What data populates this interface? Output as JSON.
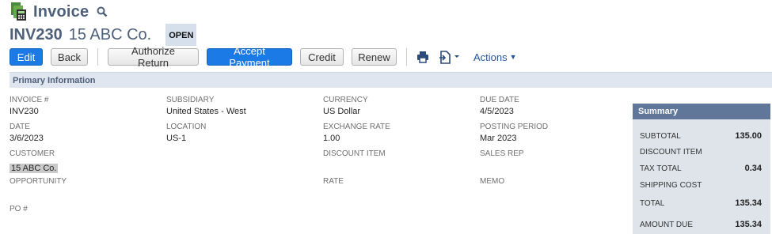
{
  "header": {
    "title": "Invoice",
    "record_id": "INV230",
    "record_name": "15 ABC Co.",
    "status": "OPEN"
  },
  "toolbar": {
    "edit": "Edit",
    "back": "Back",
    "authorize_return": "Authorize Return",
    "accept_payment": "Accept Payment",
    "credit": "Credit",
    "renew": "Renew",
    "actions": "Actions"
  },
  "section": {
    "title": "Primary Information"
  },
  "fields": {
    "invoice_no": {
      "label": "INVOICE #",
      "value": "INV230"
    },
    "date": {
      "label": "DATE",
      "value": "3/6/2023"
    },
    "customer": {
      "label": "CUSTOMER",
      "value": "15 ABC Co."
    },
    "opportunity": {
      "label": "OPPORTUNITY"
    },
    "po": {
      "label": "PO #"
    },
    "subsidiary": {
      "label": "SUBSIDIARY",
      "value": "United States - West"
    },
    "location": {
      "label": "LOCATION",
      "value": "US-1"
    },
    "currency": {
      "label": "CURRENCY",
      "value": "US Dollar"
    },
    "exchange_rate": {
      "label": "EXCHANGE RATE",
      "value": "1.00"
    },
    "discount_item": {
      "label": "DISCOUNT ITEM"
    },
    "rate": {
      "label": "RATE"
    },
    "due_date": {
      "label": "DUE DATE",
      "value": "4/5/2023"
    },
    "posting_period": {
      "label": "POSTING PERIOD",
      "value": "Mar 2023"
    },
    "sales_rep": {
      "label": "SALES REP"
    },
    "memo": {
      "label": "MEMO"
    }
  },
  "summary": {
    "title": "Summary",
    "subtotal_label": "SUBTOTAL",
    "subtotal": "135.00",
    "discount_item_label": "DISCOUNT ITEM",
    "tax_total_label": "TAX TOTAL",
    "tax_total": "0.34",
    "shipping_cost_label": "SHIPPING COST",
    "total_label": "TOTAL",
    "total": "135.34",
    "amount_due_label": "AMOUNT DUE",
    "amount_due": "135.34"
  },
  "colors": {
    "primary_button": "#1c7ae6",
    "title_text": "#4d5f79",
    "section_bar": "#e0e6ef",
    "summary_header": "#607799",
    "summary_body": "#dfe4eb"
  },
  "icons": [
    "invoice-doc-icon",
    "search-icon",
    "print-icon",
    "export-icon"
  ]
}
